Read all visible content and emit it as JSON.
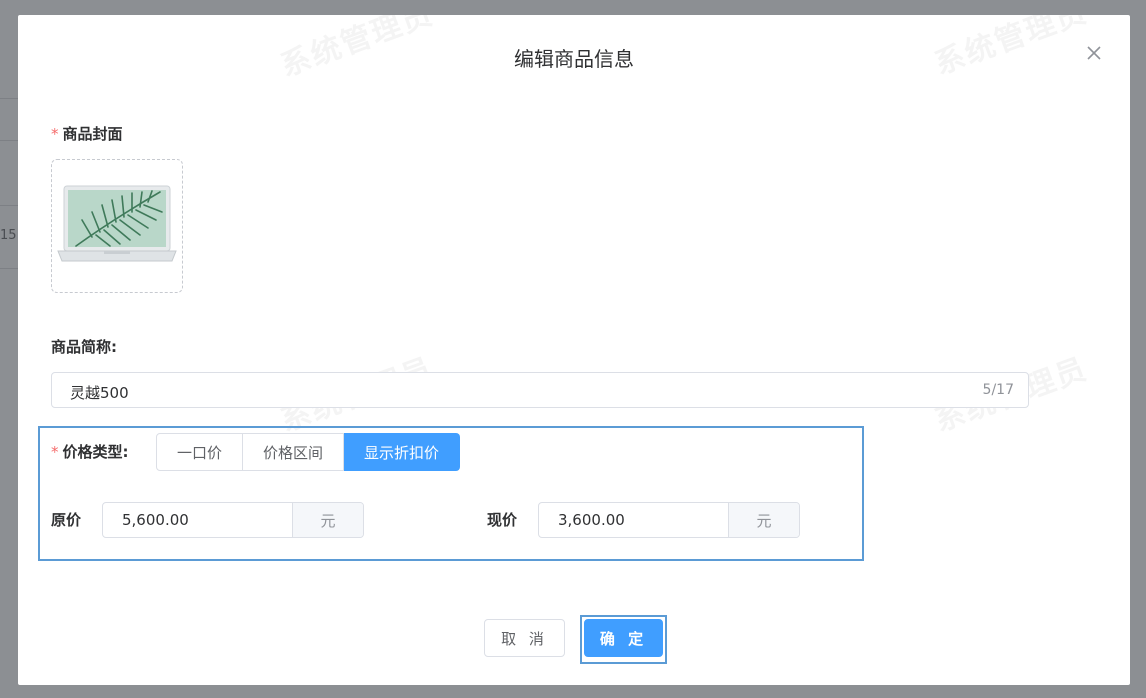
{
  "background": {
    "row_text": "15"
  },
  "dialog": {
    "title": "编辑商品信息",
    "watermark": "系统管理员"
  },
  "cover": {
    "label": "商品封面",
    "image": "laptop-with-palm-leaf-wallpaper"
  },
  "name_field": {
    "label": "商品简称:",
    "value": "灵越500",
    "counter": "5/17"
  },
  "price_type": {
    "label": "价格类型:",
    "options": [
      "一口价",
      "价格区间",
      "显示折扣价"
    ],
    "selected": "显示折扣价"
  },
  "original_price": {
    "label": "原价",
    "value": "5,600.00",
    "unit": "元"
  },
  "current_price": {
    "label": "现价",
    "value": "3,600.00",
    "unit": "元"
  },
  "footer": {
    "cancel_label": "取 消",
    "ok_label": "确 定"
  },
  "colors": {
    "primary": "#409eff",
    "required": "#f56c6c",
    "highlight_frame": "#5b9bd5"
  }
}
